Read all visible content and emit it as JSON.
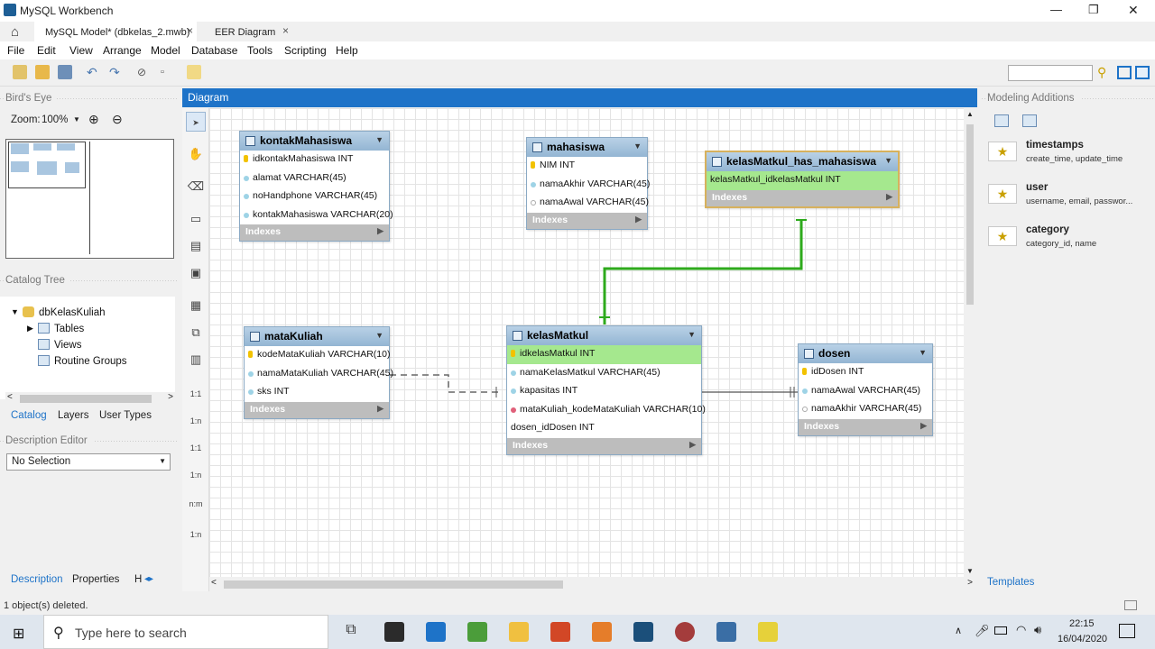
{
  "window": {
    "title": "MySQL Workbench",
    "minimize": "—",
    "maximize": "❐",
    "close": "✕"
  },
  "tabs": [
    {
      "label": "MySQL Model* (dbkelas_2.mwb)",
      "close": "×"
    },
    {
      "label": "EER Diagram",
      "close": "×"
    }
  ],
  "menu": [
    "File",
    "Edit",
    "View",
    "Arrange",
    "Model",
    "Database",
    "Tools",
    "Scripting",
    "Help"
  ],
  "left": {
    "birds_eye": "Bird's Eye",
    "zoom_label": "Zoom:",
    "zoom_value": "100%",
    "catalog_tree": "Catalog Tree",
    "tree": {
      "root": "dbKelasKuliah",
      "items": [
        "Tables",
        "Views",
        "Routine Groups"
      ]
    },
    "tabs": [
      "Catalog",
      "Layers",
      "User Types"
    ],
    "description_editor": "Description Editor",
    "selection": "No Selection",
    "bottom_tabs": [
      "Description",
      "Properties",
      "H"
    ]
  },
  "diagram": {
    "title": "Diagram",
    "tables": {
      "kontak": {
        "name": "kontakMahasiswa",
        "cols": [
          "idkontakMahasiswa INT",
          "alamat VARCHAR(45)",
          "noHandphone VARCHAR(45)",
          "kontakMahasiswa VARCHAR(20)"
        ],
        "indexes": "Indexes"
      },
      "mahasiswa": {
        "name": "mahasiswa",
        "cols": [
          "NIM INT",
          "namaAkhir VARCHAR(45)",
          "namaAwal VARCHAR(45)"
        ],
        "indexes": "Indexes"
      },
      "khm": {
        "name": "kelasMatkul_has_mahasiswa",
        "cols": [
          "kelasMatkul_idkelasMatkul INT"
        ],
        "indexes": "Indexes"
      },
      "matakuliah": {
        "name": "mataKuliah",
        "cols": [
          "kodeMataKuliah VARCHAR(10)",
          "namaMataKuliah VARCHAR(45)",
          "sks INT"
        ],
        "indexes": "Indexes"
      },
      "kelasmatkul": {
        "name": "kelasMatkul",
        "cols": [
          "idkelasMatkul INT",
          "namaKelasMatkul VARCHAR(45)",
          "kapasitas INT",
          "mataKuliah_kodeMataKuliah VARCHAR(10)",
          "dosen_idDosen INT"
        ],
        "indexes": "Indexes"
      },
      "dosen": {
        "name": "dosen",
        "cols": [
          "idDosen INT",
          "namaAwal VARCHAR(45)",
          "namaAkhir VARCHAR(45)"
        ],
        "indexes": "Indexes"
      }
    },
    "palette": [
      "1:1",
      "1:n",
      "1:1",
      "1:n",
      "n:m",
      "1:n"
    ]
  },
  "right": {
    "title": "Modeling Additions",
    "templates": [
      {
        "name": "timestamps",
        "desc": "create_time, update_time"
      },
      {
        "name": "user",
        "desc": "username, email, passwor..."
      },
      {
        "name": "category",
        "desc": "category_id, name"
      }
    ],
    "templates_tab": "Templates"
  },
  "status": "1 object(s) deleted.",
  "taskbar": {
    "search_placeholder": "Type here to search",
    "time": "22:15",
    "date": "16/04/2020"
  }
}
